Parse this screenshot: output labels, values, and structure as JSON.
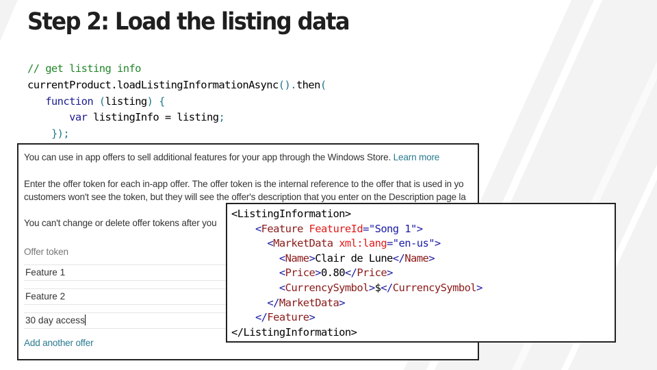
{
  "slide": {
    "title": "Step 2: Load the listing data",
    "colors": {
      "background": "#ffffff",
      "background_stripes": "#f3f3f3",
      "panel_border": "#222222",
      "link": "#2a7a8f"
    }
  },
  "code_snippet": {
    "language": "javascript",
    "lines": [
      {
        "comment": "// get listing info"
      },
      {
        "text": "currentProduct.loadListingInformationAsync().then("
      },
      {
        "keyword": "function",
        "text": " (listing) {"
      },
      {
        "keyword": "var",
        "text": " listingInfo = listing;"
      },
      {
        "text": "});"
      }
    ],
    "line_1": "// get listing info",
    "line_2_object": "currentProduct.loadListingInformationAsync",
    "line_2_call": "().",
    "line_2_then": "then",
    "line_2_open": "(",
    "line_3_keyword": "function",
    "line_3_open": " (",
    "line_3_param": "listing",
    "line_3_close": ") {",
    "line_4_keyword": "var",
    "line_4_text": " listingInfo = listing",
    "line_4_semi": ";",
    "line_5": "});"
  },
  "store_screenshot": {
    "intro_text": "You can use in app offers to sell additional features for your app through the Windows Store.",
    "learn_more_link": "Learn more",
    "instructions_line1": "Enter the offer token for each in-app offer. The offer token is the internal reference to the offer that is used in yo",
    "instructions_line2": "customers won't see the token, but they will see the offer's description that you enter on the Description page la",
    "warning_text": "You can't change or delete offer tokens after you",
    "offer_token_label": "Offer token",
    "offer_tokens": [
      "Feature 1",
      "Feature 2",
      "30 day access"
    ],
    "add_offer_link": "Add another offer"
  },
  "xml_snippet": {
    "root_open": "<ListingInformation>",
    "root_close": "</ListingInformation>",
    "feature_element": "Feature",
    "feature_attr": "FeatureId",
    "feature_attr_value": "\"Song 1\"",
    "market_element": "MarketData",
    "market_attr": "xml:lang",
    "market_attr_value": "\"en-us\"",
    "name_element": "Name",
    "name_value": "Clair de Lune",
    "price_element": "Price",
    "price_value": "0.80",
    "currency_element": "CurrencySymbol",
    "currency_value": "$"
  }
}
